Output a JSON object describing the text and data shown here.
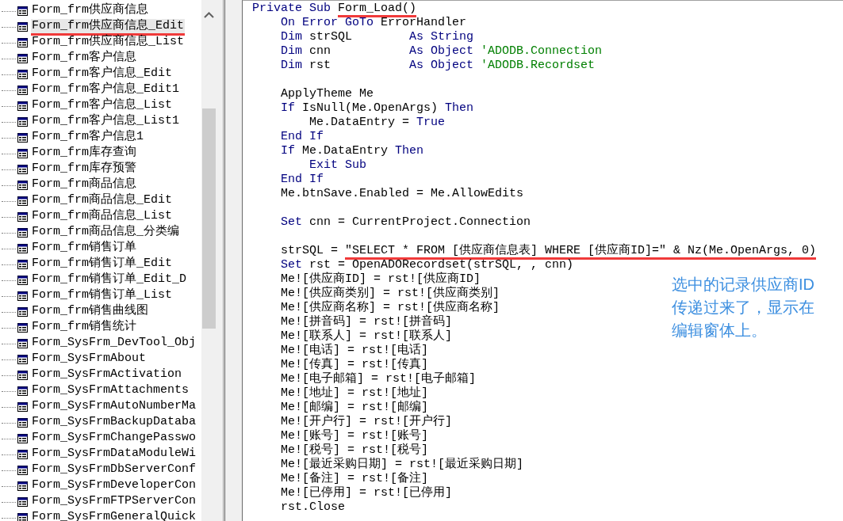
{
  "project_tree": {
    "items": [
      {
        "label": "Form_frm供应商信息",
        "selected": false,
        "underlined": false
      },
      {
        "label": "Form_frm供应商信息_Edit",
        "selected": true,
        "underlined": true
      },
      {
        "label": "Form_frm供应商信息_List",
        "selected": false,
        "underlined": false
      },
      {
        "label": "Form_frm客户信息",
        "selected": false,
        "underlined": false
      },
      {
        "label": "Form_frm客户信息_Edit",
        "selected": false,
        "underlined": false
      },
      {
        "label": "Form_frm客户信息_Edit1",
        "selected": false,
        "underlined": false
      },
      {
        "label": "Form_frm客户信息_List",
        "selected": false,
        "underlined": false
      },
      {
        "label": "Form_frm客户信息_List1",
        "selected": false,
        "underlined": false
      },
      {
        "label": "Form_frm客户信息1",
        "selected": false,
        "underlined": false
      },
      {
        "label": "Form_frm库存查询",
        "selected": false,
        "underlined": false
      },
      {
        "label": "Form_frm库存预警",
        "selected": false,
        "underlined": false
      },
      {
        "label": "Form_frm商品信息",
        "selected": false,
        "underlined": false
      },
      {
        "label": "Form_frm商品信息_Edit",
        "selected": false,
        "underlined": false
      },
      {
        "label": "Form_frm商品信息_List",
        "selected": false,
        "underlined": false
      },
      {
        "label": "Form_frm商品信息_分类编",
        "selected": false,
        "underlined": false
      },
      {
        "label": "Form_frm销售订单",
        "selected": false,
        "underlined": false
      },
      {
        "label": "Form_frm销售订单_Edit",
        "selected": false,
        "underlined": false
      },
      {
        "label": "Form_frm销售订单_Edit_D",
        "selected": false,
        "underlined": false
      },
      {
        "label": "Form_frm销售订单_List",
        "selected": false,
        "underlined": false
      },
      {
        "label": "Form_frm销售曲线图",
        "selected": false,
        "underlined": false
      },
      {
        "label": "Form_frm销售统计",
        "selected": false,
        "underlined": false
      },
      {
        "label": "Form_SysFrm_DevTool_Obj",
        "selected": false,
        "underlined": false
      },
      {
        "label": "Form_SysFrmAbout",
        "selected": false,
        "underlined": false
      },
      {
        "label": "Form_SysFrmActivation",
        "selected": false,
        "underlined": false
      },
      {
        "label": "Form_SysFrmAttachments",
        "selected": false,
        "underlined": false
      },
      {
        "label": "Form_SysFrmAutoNumberMa",
        "selected": false,
        "underlined": false
      },
      {
        "label": "Form_SysFrmBackupDataba",
        "selected": false,
        "underlined": false
      },
      {
        "label": "Form_SysFrmChangePasswo",
        "selected": false,
        "underlined": false
      },
      {
        "label": "Form_SysFrmDataModuleWi",
        "selected": false,
        "underlined": false
      },
      {
        "label": "Form_SysFrmDbServerConf",
        "selected": false,
        "underlined": false
      },
      {
        "label": "Form_SysFrmDeveloperCon",
        "selected": false,
        "underlined": false
      },
      {
        "label": "Form_SysFrmFTPServerCon",
        "selected": false,
        "underlined": false
      },
      {
        "label": "Form_SysFrmGeneralQuick",
        "selected": false,
        "underlined": false
      }
    ]
  },
  "code_window": {
    "blocks": [
      {
        "lines": [
          {
            "segments": [
              {
                "kind": "keyword",
                "text": "Private Sub "
              },
              {
                "kind": "text",
                "text": "Form_Load()",
                "underlined": true
              }
            ]
          },
          {
            "segments": [
              {
                "kind": "keyword",
                "text": "    On Error GoTo"
              },
              {
                "kind": "text",
                "text": " ErrorHandler"
              }
            ]
          },
          {
            "segments": [
              {
                "kind": "keyword",
                "text": "    Dim"
              },
              {
                "kind": "text",
                "text": " strSQL        "
              },
              {
                "kind": "keyword",
                "text": "As String"
              }
            ]
          },
          {
            "segments": [
              {
                "kind": "keyword",
                "text": "    Dim"
              },
              {
                "kind": "text",
                "text": " cnn           "
              },
              {
                "kind": "keyword",
                "text": "As Object"
              },
              {
                "kind": "comment",
                "text": " 'ADODB.Connection"
              }
            ]
          },
          {
            "segments": [
              {
                "kind": "keyword",
                "text": "    Dim"
              },
              {
                "kind": "text",
                "text": " rst           "
              },
              {
                "kind": "keyword",
                "text": "As Object"
              },
              {
                "kind": "comment",
                "text": " 'ADODB.Recordset"
              }
            ]
          }
        ]
      },
      {
        "lines": [
          {
            "segments": [
              {
                "kind": "text",
                "text": "    ApplyTheme Me"
              }
            ]
          },
          {
            "segments": [
              {
                "kind": "keyword",
                "text": "    If"
              },
              {
                "kind": "text",
                "text": " IsNull(Me.OpenArgs) "
              },
              {
                "kind": "keyword",
                "text": "Then"
              }
            ]
          },
          {
            "segments": [
              {
                "kind": "text",
                "text": "        Me.DataEntry = "
              },
              {
                "kind": "keyword",
                "text": "True"
              }
            ]
          },
          {
            "segments": [
              {
                "kind": "keyword",
                "text": "    End If"
              }
            ]
          },
          {
            "segments": [
              {
                "kind": "keyword",
                "text": "    If"
              },
              {
                "kind": "text",
                "text": " Me.DataEntry "
              },
              {
                "kind": "keyword",
                "text": "Then"
              }
            ]
          },
          {
            "segments": [
              {
                "kind": "keyword",
                "text": "        Exit Sub"
              }
            ]
          },
          {
            "segments": [
              {
                "kind": "keyword",
                "text": "    End If"
              }
            ]
          },
          {
            "segments": [
              {
                "kind": "text",
                "text": "    Me.btnSave.Enabled = Me.AllowEdits"
              }
            ]
          }
        ]
      },
      {
        "lines": [
          {
            "segments": [
              {
                "kind": "keyword",
                "text": "    Set"
              },
              {
                "kind": "text",
                "text": " cnn = CurrentProject.Connection"
              }
            ]
          }
        ]
      },
      {
        "lines": [
          {
            "segments": [
              {
                "kind": "text",
                "text": "    strSQL = "
              },
              {
                "kind": "text",
                "text": "\"SELECT * FROM [供应商信息表] WHERE [供应商ID]=\" & Nz(Me.OpenArgs, 0)",
                "underlined": true
              }
            ]
          },
          {
            "segments": [
              {
                "kind": "keyword",
                "text": "    Set"
              },
              {
                "kind": "text",
                "text": " rst = OpenADORecordset(strSQL, , cnn)"
              }
            ]
          },
          {
            "segments": [
              {
                "kind": "text",
                "text": "    Me![供应商ID] = rst![供应商ID]"
              }
            ]
          },
          {
            "segments": [
              {
                "kind": "text",
                "text": "    Me![供应商类别] = rst![供应商类别]"
              }
            ]
          },
          {
            "segments": [
              {
                "kind": "text",
                "text": "    Me![供应商名称] = rst![供应商名称]"
              }
            ]
          },
          {
            "segments": [
              {
                "kind": "text",
                "text": "    Me![拼音码] = rst![拼音码]"
              }
            ]
          },
          {
            "segments": [
              {
                "kind": "text",
                "text": "    Me![联系人] = rst![联系人]"
              }
            ]
          },
          {
            "segments": [
              {
                "kind": "text",
                "text": "    Me![电话] = rst![电话]"
              }
            ]
          },
          {
            "segments": [
              {
                "kind": "text",
                "text": "    Me![传真] = rst![传真]"
              }
            ]
          },
          {
            "segments": [
              {
                "kind": "text",
                "text": "    Me![电子邮箱] = rst![电子邮箱]"
              }
            ]
          },
          {
            "segments": [
              {
                "kind": "text",
                "text": "    Me![地址] = rst![地址]"
              }
            ]
          },
          {
            "segments": [
              {
                "kind": "text",
                "text": "    Me![邮编] = rst![邮编]"
              }
            ]
          },
          {
            "segments": [
              {
                "kind": "text",
                "text": "    Me![开户行] = rst![开户行]"
              }
            ]
          },
          {
            "segments": [
              {
                "kind": "text",
                "text": "    Me![账号] = rst![账号]"
              }
            ]
          },
          {
            "segments": [
              {
                "kind": "text",
                "text": "    Me![税号] = rst![税号]"
              }
            ]
          },
          {
            "segments": [
              {
                "kind": "text",
                "text": "    Me![最近采购日期] = rst![最近采购日期]"
              }
            ]
          },
          {
            "segments": [
              {
                "kind": "text",
                "text": "    Me![备注] = rst![备注]"
              }
            ]
          },
          {
            "segments": [
              {
                "kind": "text",
                "text": "    Me![已停用] = rst![已停用]"
              }
            ]
          },
          {
            "segments": [
              {
                "kind": "text",
                "text": "    rst.Close"
              }
            ]
          }
        ]
      }
    ]
  },
  "annotation": {
    "lines": [
      "选中的记录供应商ID",
      "传递过来了，显示在",
      "编辑窗体上。"
    ]
  }
}
